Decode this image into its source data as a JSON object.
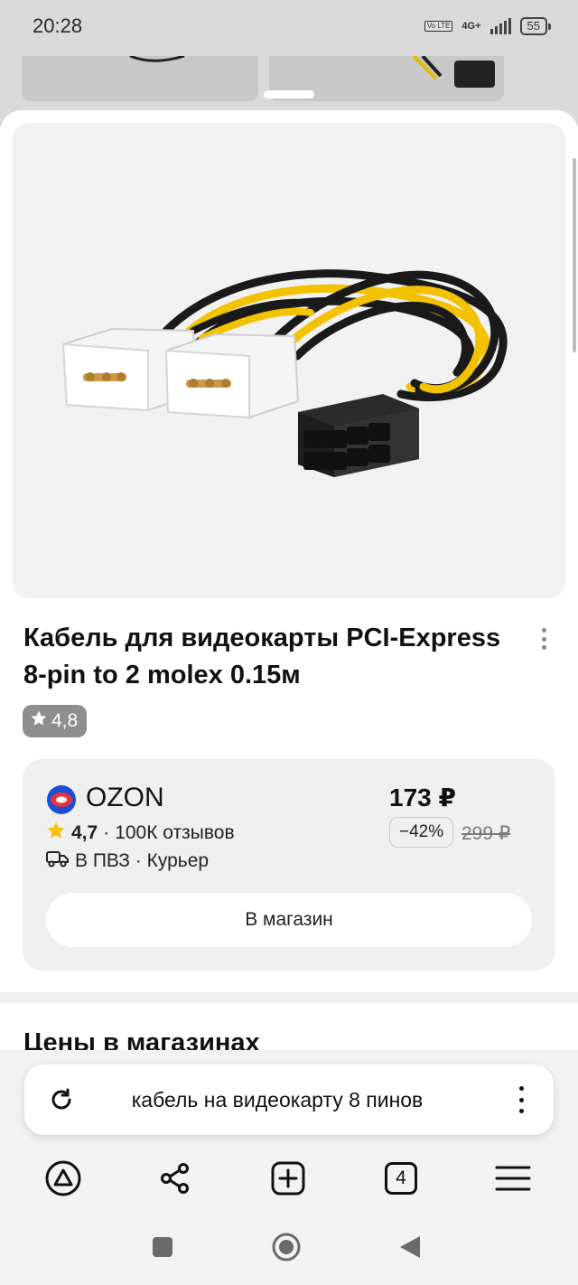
{
  "status_bar": {
    "time": "20:28",
    "volte": "Vo LTE",
    "network": "4G+",
    "battery": "55"
  },
  "product": {
    "title": "Кабель для видеокарты PCI-Express 8-pin to 2 molex 0.15м",
    "rating": "4,8"
  },
  "offer": {
    "shop_name": "OZON",
    "shop_rating": "4,7",
    "reviews": "100К отзывов",
    "delivery": "В ПВЗ · Курьер",
    "price": "173 ₽",
    "discount": "−42%",
    "old_price": "299 ₽",
    "store_button": "В магазин"
  },
  "section": {
    "heading": "Цены в магазинах"
  },
  "search": {
    "query": "кабель на видеокарту 8 пинов"
  },
  "toolbar": {
    "tabs_count": "4"
  },
  "colors": {
    "ozon_red": "#e8333c",
    "ozon_blue": "#1b4fd6",
    "star": "#f5c000"
  },
  "icons": {
    "toolbar": [
      "alice-icon",
      "share-icon",
      "new-tab-icon",
      "tabs-icon",
      "menu-icon"
    ],
    "system_nav": [
      "recents-icon",
      "home-icon",
      "back-icon"
    ]
  }
}
